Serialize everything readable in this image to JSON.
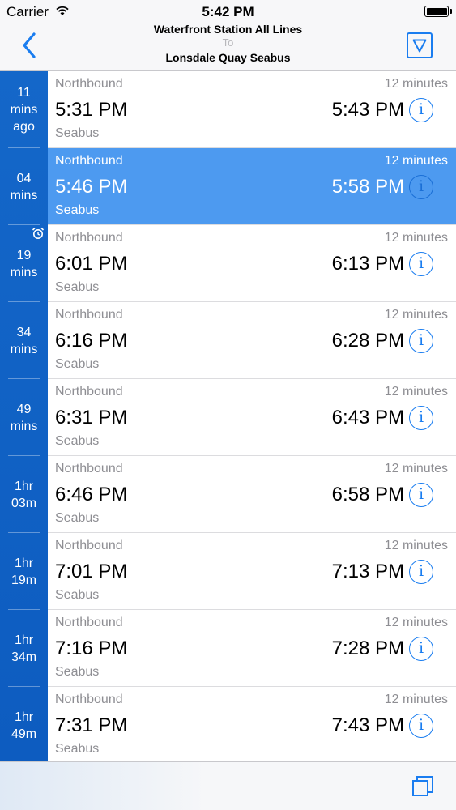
{
  "status_bar": {
    "carrier": "Carrier",
    "time": "5:42 PM",
    "battery_level": 1.0
  },
  "header": {
    "from": "Waterfront Station All Lines",
    "to_label": "To",
    "destination": "Lonsdale Quay Seabus"
  },
  "colors": {
    "accent": "#1a7df0",
    "eta_column": "#1467c9",
    "highlight_row": "#4d9af0"
  },
  "departures": [
    {
      "eta": "11\nmins\nago",
      "direction": "Northbound",
      "duration": "12 minutes",
      "depart": "5:31 PM",
      "arrive": "5:43 PM",
      "mode": "Seabus",
      "highlight": false,
      "alarm": false
    },
    {
      "eta": "04\nmins",
      "direction": "Northbound",
      "duration": "12 minutes",
      "depart": "5:46 PM",
      "arrive": "5:58 PM",
      "mode": "Seabus",
      "highlight": true,
      "alarm": false
    },
    {
      "eta": "19\nmins",
      "direction": "Northbound",
      "duration": "12 minutes",
      "depart": "6:01 PM",
      "arrive": "6:13 PM",
      "mode": "Seabus",
      "highlight": false,
      "alarm": true
    },
    {
      "eta": "34\nmins",
      "direction": "Northbound",
      "duration": "12 minutes",
      "depart": "6:16 PM",
      "arrive": "6:28 PM",
      "mode": "Seabus",
      "highlight": false,
      "alarm": false
    },
    {
      "eta": "49\nmins",
      "direction": "Northbound",
      "duration": "12 minutes",
      "depart": "6:31 PM",
      "arrive": "6:43 PM",
      "mode": "Seabus",
      "highlight": false,
      "alarm": false
    },
    {
      "eta": "1hr\n03m",
      "direction": "Northbound",
      "duration": "12 minutes",
      "depart": "6:46 PM",
      "arrive": "6:58 PM",
      "mode": "Seabus",
      "highlight": false,
      "alarm": false
    },
    {
      "eta": "1hr\n19m",
      "direction": "Northbound",
      "duration": "12 minutes",
      "depart": "7:01 PM",
      "arrive": "7:13 PM",
      "mode": "Seabus",
      "highlight": false,
      "alarm": false
    },
    {
      "eta": "1hr\n34m",
      "direction": "Northbound",
      "duration": "12 minutes",
      "depart": "7:16 PM",
      "arrive": "7:28 PM",
      "mode": "Seabus",
      "highlight": false,
      "alarm": false
    },
    {
      "eta": "1hr\n49m",
      "direction": "Northbound",
      "duration": "12 minutes",
      "depart": "7:31 PM",
      "arrive": "7:43 PM",
      "mode": "Seabus",
      "highlight": false,
      "alarm": false
    }
  ],
  "icons": {
    "back": "chevron-left-icon",
    "filter": "filter-triangle-icon",
    "info": "info-icon",
    "alarm": "alarm-clock-icon",
    "copy": "copy-icon",
    "wifi": "wifi-icon",
    "battery": "battery-icon"
  }
}
